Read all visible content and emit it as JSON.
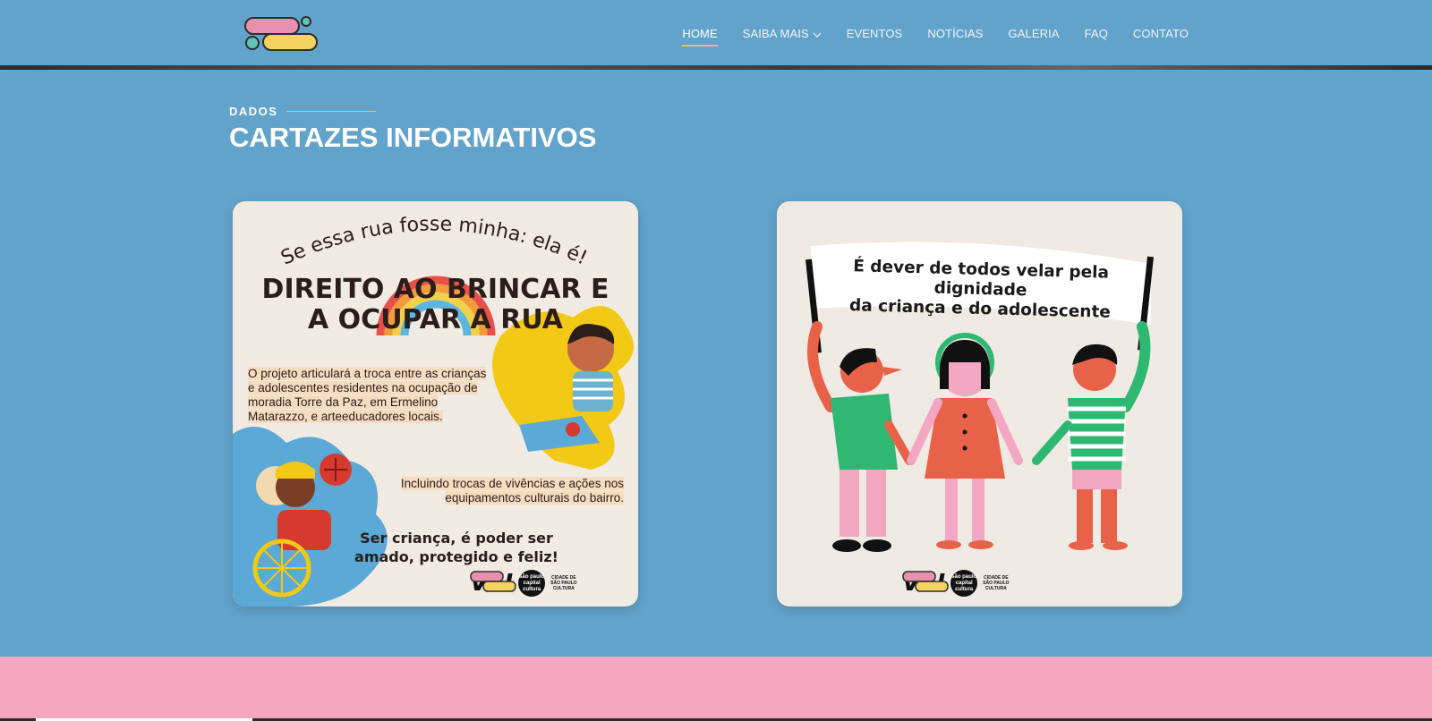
{
  "header": {
    "logo_alt": "Amigos do Bairro",
    "nav": [
      {
        "label": "HOME",
        "active": true
      },
      {
        "label": "SAIBA MAIS",
        "dropdown": true
      },
      {
        "label": "EVENTOS"
      },
      {
        "label": "NOTÍCIAS"
      },
      {
        "label": "GALERIA"
      },
      {
        "label": "FAQ"
      },
      {
        "label": "CONTATO"
      }
    ]
  },
  "section": {
    "eyebrow": "DADOS",
    "title": "CARTAZES INFORMATIVOS"
  },
  "poster1": {
    "arc_text": "Se essa rua fosse minha: ela é!",
    "title_line1": "DIREITO AO BRINCAR E",
    "title_line2": "A OCUPAR A RUA",
    "body1_l1": "O projeto articulará a troca entre as crianças",
    "body1_l2": "e adolescentes residentes na ocupação de",
    "body1_l3": "moradia Torre da Paz, em Ermelino",
    "body1_l4": "Matarazzo, e arteeducadores locais.",
    "body2_l1": "Incluindo trocas de vivências e ações nos",
    "body2_l2": "equipamentos culturais do bairro.",
    "slogan_l1": "Ser criança, é poder ser",
    "slogan_l2": "amado, protegido e feliz!"
  },
  "poster2": {
    "banner_l1": "É dever de todos velar pela dignidade",
    "banner_l2": "da criança e do adolescente"
  },
  "sponsors": {
    "vai": "VAI",
    "sp1": "são paulo capital cultura",
    "sp2_l1": "CIDADE DE",
    "sp2_l2": "SÃO PAULO",
    "sp2_l3": "CULTURA"
  },
  "colors": {
    "page_bg": "#62a3cb",
    "accent": "#f2c14e",
    "pink_band": "#f5a7c0"
  }
}
